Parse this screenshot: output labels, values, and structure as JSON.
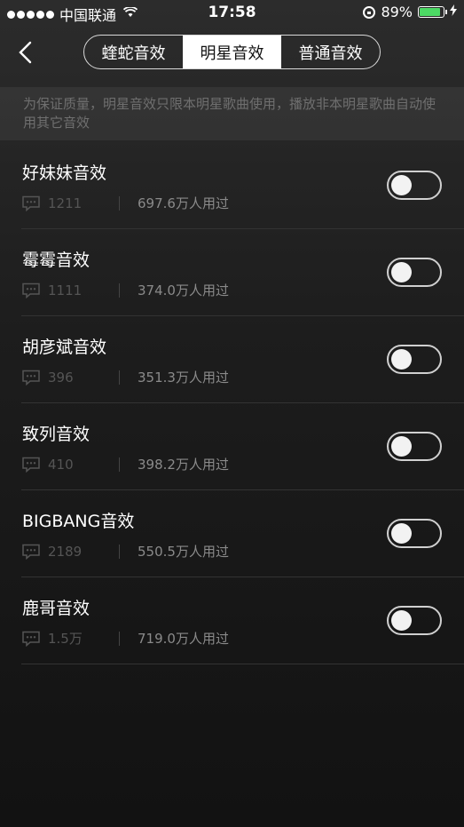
{
  "status_bar": {
    "carrier": "中国联通",
    "time": "17:58",
    "battery": "89%",
    "battery_level": 0.89,
    "icons": [
      "signal-dots",
      "wifi-icon",
      "rotation-lock-icon",
      "battery-icon",
      "charging-bolt-icon"
    ]
  },
  "nav": {
    "back_icon": "chevron-left-icon",
    "tabs": [
      {
        "label": "蝰蛇音效",
        "active": false
      },
      {
        "label": "明星音效",
        "active": true
      },
      {
        "label": "普通音效",
        "active": false
      }
    ]
  },
  "notice": "为保证质量，明星音效只限本明星歌曲使用，播放非本明星歌曲自动使用其它音效",
  "effects": [
    {
      "name": "好妹妹音效",
      "comments": "1211",
      "users": "697.6万人用过",
      "enabled": false
    },
    {
      "name": "霉霉音效",
      "comments": "1111",
      "users": "374.0万人用过",
      "enabled": false
    },
    {
      "name": "胡彦斌音效",
      "comments": "396",
      "users": "351.3万人用过",
      "enabled": false
    },
    {
      "name": "致列音效",
      "comments": "410",
      "users": "398.2万人用过",
      "enabled": false
    },
    {
      "name": "BIGBANG音效",
      "comments": "2189",
      "users": "550.5万人用过",
      "enabled": false
    },
    {
      "name": "鹿哥音效",
      "comments": "1.5万",
      "users": "719.0万人用过",
      "enabled": false
    }
  ],
  "colors": {
    "background": "#1d1d1d",
    "battery": "#4cd964",
    "toggle_border": "#d0d0d0"
  }
}
